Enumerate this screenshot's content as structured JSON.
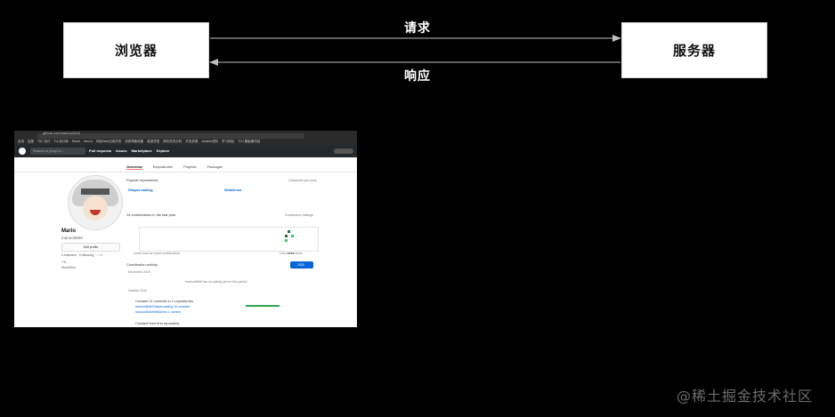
{
  "diagram": {
    "browser_label": "浏览器",
    "server_label": "服务器",
    "request_label": "请求",
    "response_label": "响应",
    "arrow_color": "#bfbfbf"
  },
  "screenshot": {
    "url_text": "github.com/mariuo0606",
    "bookmarks": [
      "应用",
      "百度",
      "T5C 执行",
      "Tul 设计库",
      "React",
      "fdxc.io",
      "网站Web应用开发",
      "优质博客收集",
      "逛逛学堂",
      "简历任务分析",
      "开发资源",
      "Airtable资料",
      "学习网站",
      "TGJ 模板素材站"
    ],
    "search_placeholder": "Search or jump to...",
    "nav": [
      "Pull requests",
      "Issues",
      "Marketplace",
      "Explore"
    ],
    "tabs": [
      "Overview",
      "Repositories",
      "Projects",
      "Packages"
    ],
    "profile": {
      "name": "Mario",
      "login": "mariuo0606",
      "edit_button": "Edit profile",
      "follow": "0 followers · 0 following · ☆ 0",
      "company": "TTL",
      "location": "ShenZhen"
    },
    "popular_title": "Popular repositories",
    "customize": "Customize your pins",
    "repos": [
      "ShapeLoading",
      "WebDemo"
    ],
    "contributions_title": "14 contributions in the last year",
    "contribution_settings": "Contribution settings",
    "learn_link": "Learn how we count contributions",
    "less_more": "Less ■■■■ More",
    "activity_title": "Contribution activity",
    "activity_month": "November 2020",
    "activity_none": "mariuo0606 has no activity yet for this period.",
    "october": "October 2020",
    "commits_text": "Created 11 commits in 2 repositories",
    "commit_repo_1": "mariuo0606/ShapeLoading  10 commits",
    "commit_repo_2": "mariuo0606/WebDemo  1 commit",
    "first_repo": "Created their first repository",
    "year_button": "2020"
  },
  "watermark": "@稀土掘金技术社区"
}
